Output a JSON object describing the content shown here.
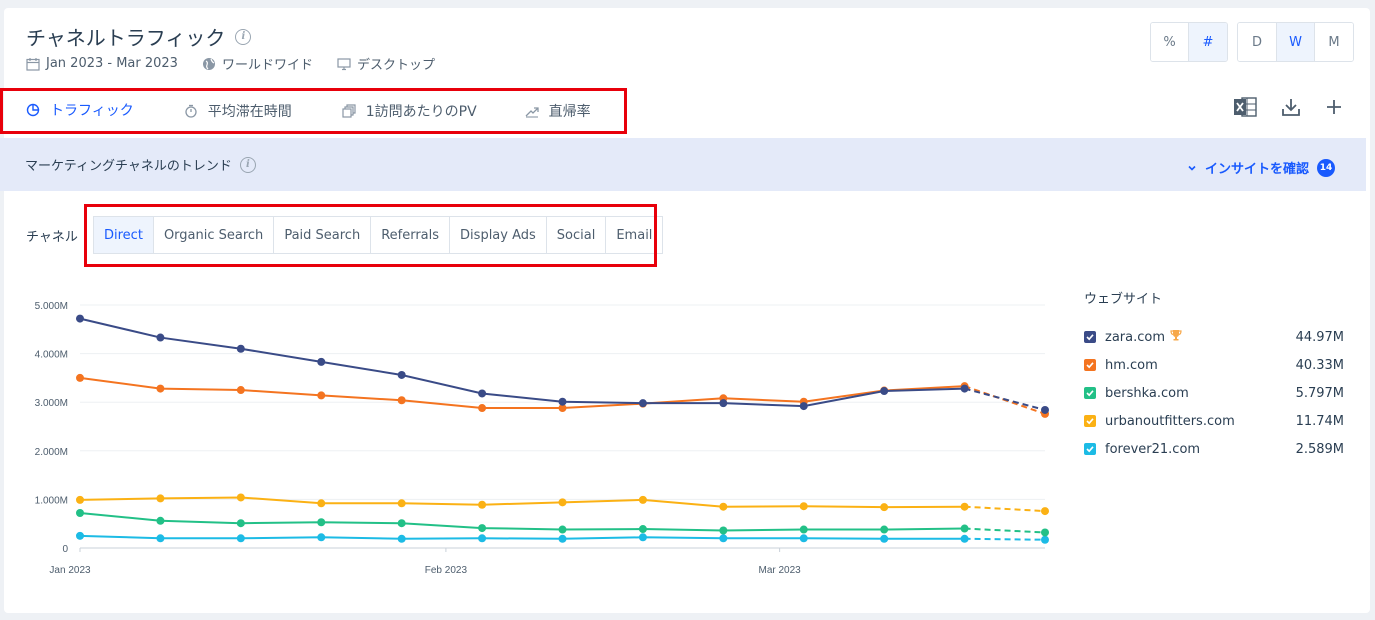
{
  "header": {
    "title": "チャネルトラフィック",
    "date_range": "Jan 2023 - Mar 2023",
    "region": "ワールドワイド",
    "device": "デスクトップ"
  },
  "value_toggle": [
    {
      "label": "%",
      "active": false
    },
    {
      "label": "#",
      "active": true
    }
  ],
  "granularity_toggle": [
    {
      "label": "D",
      "active": false
    },
    {
      "label": "W",
      "active": true
    },
    {
      "label": "M",
      "active": false
    }
  ],
  "tabs": [
    {
      "label": "トラフィック",
      "icon": "pie-chart-icon",
      "active": true
    },
    {
      "label": "平均滞在時間",
      "icon": "stopwatch-icon",
      "active": false
    },
    {
      "label": "1訪問あたりのPV",
      "icon": "pages-icon",
      "active": false
    },
    {
      "label": "直帰率",
      "icon": "trend-icon",
      "active": false
    }
  ],
  "banner": {
    "title": "マーケティングチャネルのトレンド",
    "insight_label": "インサイトを確認",
    "insight_count": "14"
  },
  "channels": {
    "label": "チャネル",
    "items": [
      {
        "label": "Direct",
        "active": true
      },
      {
        "label": "Organic Search",
        "active": false
      },
      {
        "label": "Paid Search",
        "active": false
      },
      {
        "label": "Referrals",
        "active": false
      },
      {
        "label": "Display Ads",
        "active": false
      },
      {
        "label": "Social",
        "active": false
      },
      {
        "label": "Email",
        "active": false
      }
    ]
  },
  "legend": {
    "title": "ウェブサイト",
    "items": [
      {
        "name": "zara.com",
        "value": "44.97M",
        "trophy": true
      },
      {
        "name": "hm.com",
        "value": "40.33M",
        "trophy": false
      },
      {
        "name": "bershka.com",
        "value": "5.797M",
        "trophy": false
      },
      {
        "name": "urbanoutfitters.com",
        "value": "11.74M",
        "trophy": false
      },
      {
        "name": "forever21.com",
        "value": "2.589M",
        "trophy": false
      }
    ]
  },
  "chart_data": {
    "type": "line",
    "x": [
      "2023-01-01",
      "2023-01-08",
      "2023-01-15",
      "2023-01-22",
      "2023-01-29",
      "2023-02-05",
      "2023-02-12",
      "2023-02-19",
      "2023-02-26",
      "2023-03-05",
      "2023-03-12",
      "2023-03-19",
      "2023-03-26"
    ],
    "x_ticks": [
      "Jan 2023",
      "Feb 2023",
      "Mar 2023"
    ],
    "y_ticks": [
      "0",
      "1.000M",
      "2.000M",
      "3.000M",
      "4.000M",
      "5.000M"
    ],
    "ylim": [
      0,
      5000000
    ],
    "grid": true,
    "last_segment_dashed": true,
    "series": [
      {
        "name": "zara.com",
        "color": "#3a4b87",
        "values": [
          4720000,
          4330000,
          4100000,
          3830000,
          3560000,
          3180000,
          3010000,
          2980000,
          2980000,
          2920000,
          3230000,
          3280000,
          2840000
        ]
      },
      {
        "name": "hm.com",
        "color": "#f47420",
        "values": [
          3500000,
          3280000,
          3250000,
          3140000,
          3040000,
          2880000,
          2880000,
          2970000,
          3080000,
          3010000,
          3240000,
          3330000,
          2760000
        ]
      },
      {
        "name": "bershka.com",
        "color": "#22c087",
        "values": [
          720000,
          560000,
          510000,
          530000,
          510000,
          410000,
          380000,
          390000,
          360000,
          380000,
          380000,
          400000,
          320000
        ]
      },
      {
        "name": "urbanoutfitters.com",
        "color": "#fbb114",
        "values": [
          990000,
          1020000,
          1040000,
          920000,
          920000,
          890000,
          940000,
          990000,
          850000,
          860000,
          840000,
          850000,
          760000
        ]
      },
      {
        "name": "forever21.com",
        "color": "#1cbbe5",
        "values": [
          250000,
          200000,
          200000,
          220000,
          190000,
          200000,
          190000,
          220000,
          200000,
          200000,
          190000,
          190000,
          170000
        ]
      }
    ]
  }
}
